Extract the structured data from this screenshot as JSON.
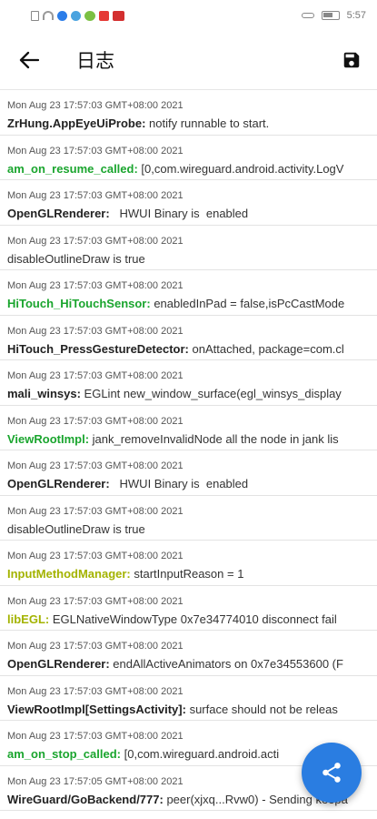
{
  "status_bar": {
    "time": "5:57"
  },
  "app_bar": {
    "title": "日志"
  },
  "colors": {
    "default_tag": "#222222",
    "green_tag": "#1aa52e",
    "olive_tag": "#a3b300",
    "fab": "#2a7de1"
  },
  "logs": [
    {
      "time": "Mon Aug 23 17:57:03 GMT+08:00 2021",
      "tag": "ZrHung.AppEyeUiProbe:",
      "msg": " notify runnable to start.",
      "color": "#222222"
    },
    {
      "time": "Mon Aug 23 17:57:03 GMT+08:00 2021",
      "tag": "am_on_resume_called:",
      "msg": " [0,com.wireguard.android.activity.LogV",
      "color": "#1aa52e"
    },
    {
      "time": "Mon Aug 23 17:57:03 GMT+08:00 2021",
      "tag": "OpenGLRenderer:",
      "msg": "   HWUI Binary is  enabled",
      "color": "#222222"
    },
    {
      "time": "Mon Aug 23 17:57:03 GMT+08:00 2021",
      "tag": "",
      "msg": "disableOutlineDraw is true",
      "color": "#222222"
    },
    {
      "time": "Mon Aug 23 17:57:03 GMT+08:00 2021",
      "tag": "HiTouch_HiTouchSensor:",
      "msg": " enabledInPad = false,isPcCastMode",
      "color": "#1aa52e"
    },
    {
      "time": "Mon Aug 23 17:57:03 GMT+08:00 2021",
      "tag": "HiTouch_PressGestureDetector:",
      "msg": " onAttached, package=com.cl",
      "color": "#222222"
    },
    {
      "time": "Mon Aug 23 17:57:03 GMT+08:00 2021",
      "tag": "mali_winsys:",
      "msg": " EGLint new_window_surface(egl_winsys_display",
      "color": "#222222"
    },
    {
      "time": "Mon Aug 23 17:57:03 GMT+08:00 2021",
      "tag": "ViewRootImpl:",
      "msg": " jank_removeInvalidNode all the node in jank lis",
      "color": "#1aa52e"
    },
    {
      "time": "Mon Aug 23 17:57:03 GMT+08:00 2021",
      "tag": "OpenGLRenderer:",
      "msg": "   HWUI Binary is  enabled",
      "color": "#222222"
    },
    {
      "time": "Mon Aug 23 17:57:03 GMT+08:00 2021",
      "tag": "",
      "msg": "disableOutlineDraw is true",
      "color": "#222222"
    },
    {
      "time": "Mon Aug 23 17:57:03 GMT+08:00 2021",
      "tag": "InputMethodManager:",
      "msg": " startInputReason = 1",
      "color": "#a3b300"
    },
    {
      "time": "Mon Aug 23 17:57:03 GMT+08:00 2021",
      "tag": "libEGL:",
      "msg": " EGLNativeWindowType 0x7e34774010 disconnect fail",
      "color": "#a3b300"
    },
    {
      "time": "Mon Aug 23 17:57:03 GMT+08:00 2021",
      "tag": "OpenGLRenderer:",
      "msg": " endAllActiveAnimators on 0x7e34553600 (F",
      "color": "#222222"
    },
    {
      "time": "Mon Aug 23 17:57:03 GMT+08:00 2021",
      "tag": "ViewRootImpl[SettingsActivity]:",
      "msg": " surface should not be releas",
      "color": "#222222"
    },
    {
      "time": "Mon Aug 23 17:57:03 GMT+08:00 2021",
      "tag": "am_on_stop_called:",
      "msg": " [0,com.wireguard.android.acti",
      "color": "#1aa52e"
    },
    {
      "time": "Mon Aug 23 17:57:05 GMT+08:00 2021",
      "tag": "WireGuard/GoBackend/777:",
      "msg": " peer(xjxq...Rvw0) - Sending keepa",
      "color": "#222222"
    }
  ]
}
